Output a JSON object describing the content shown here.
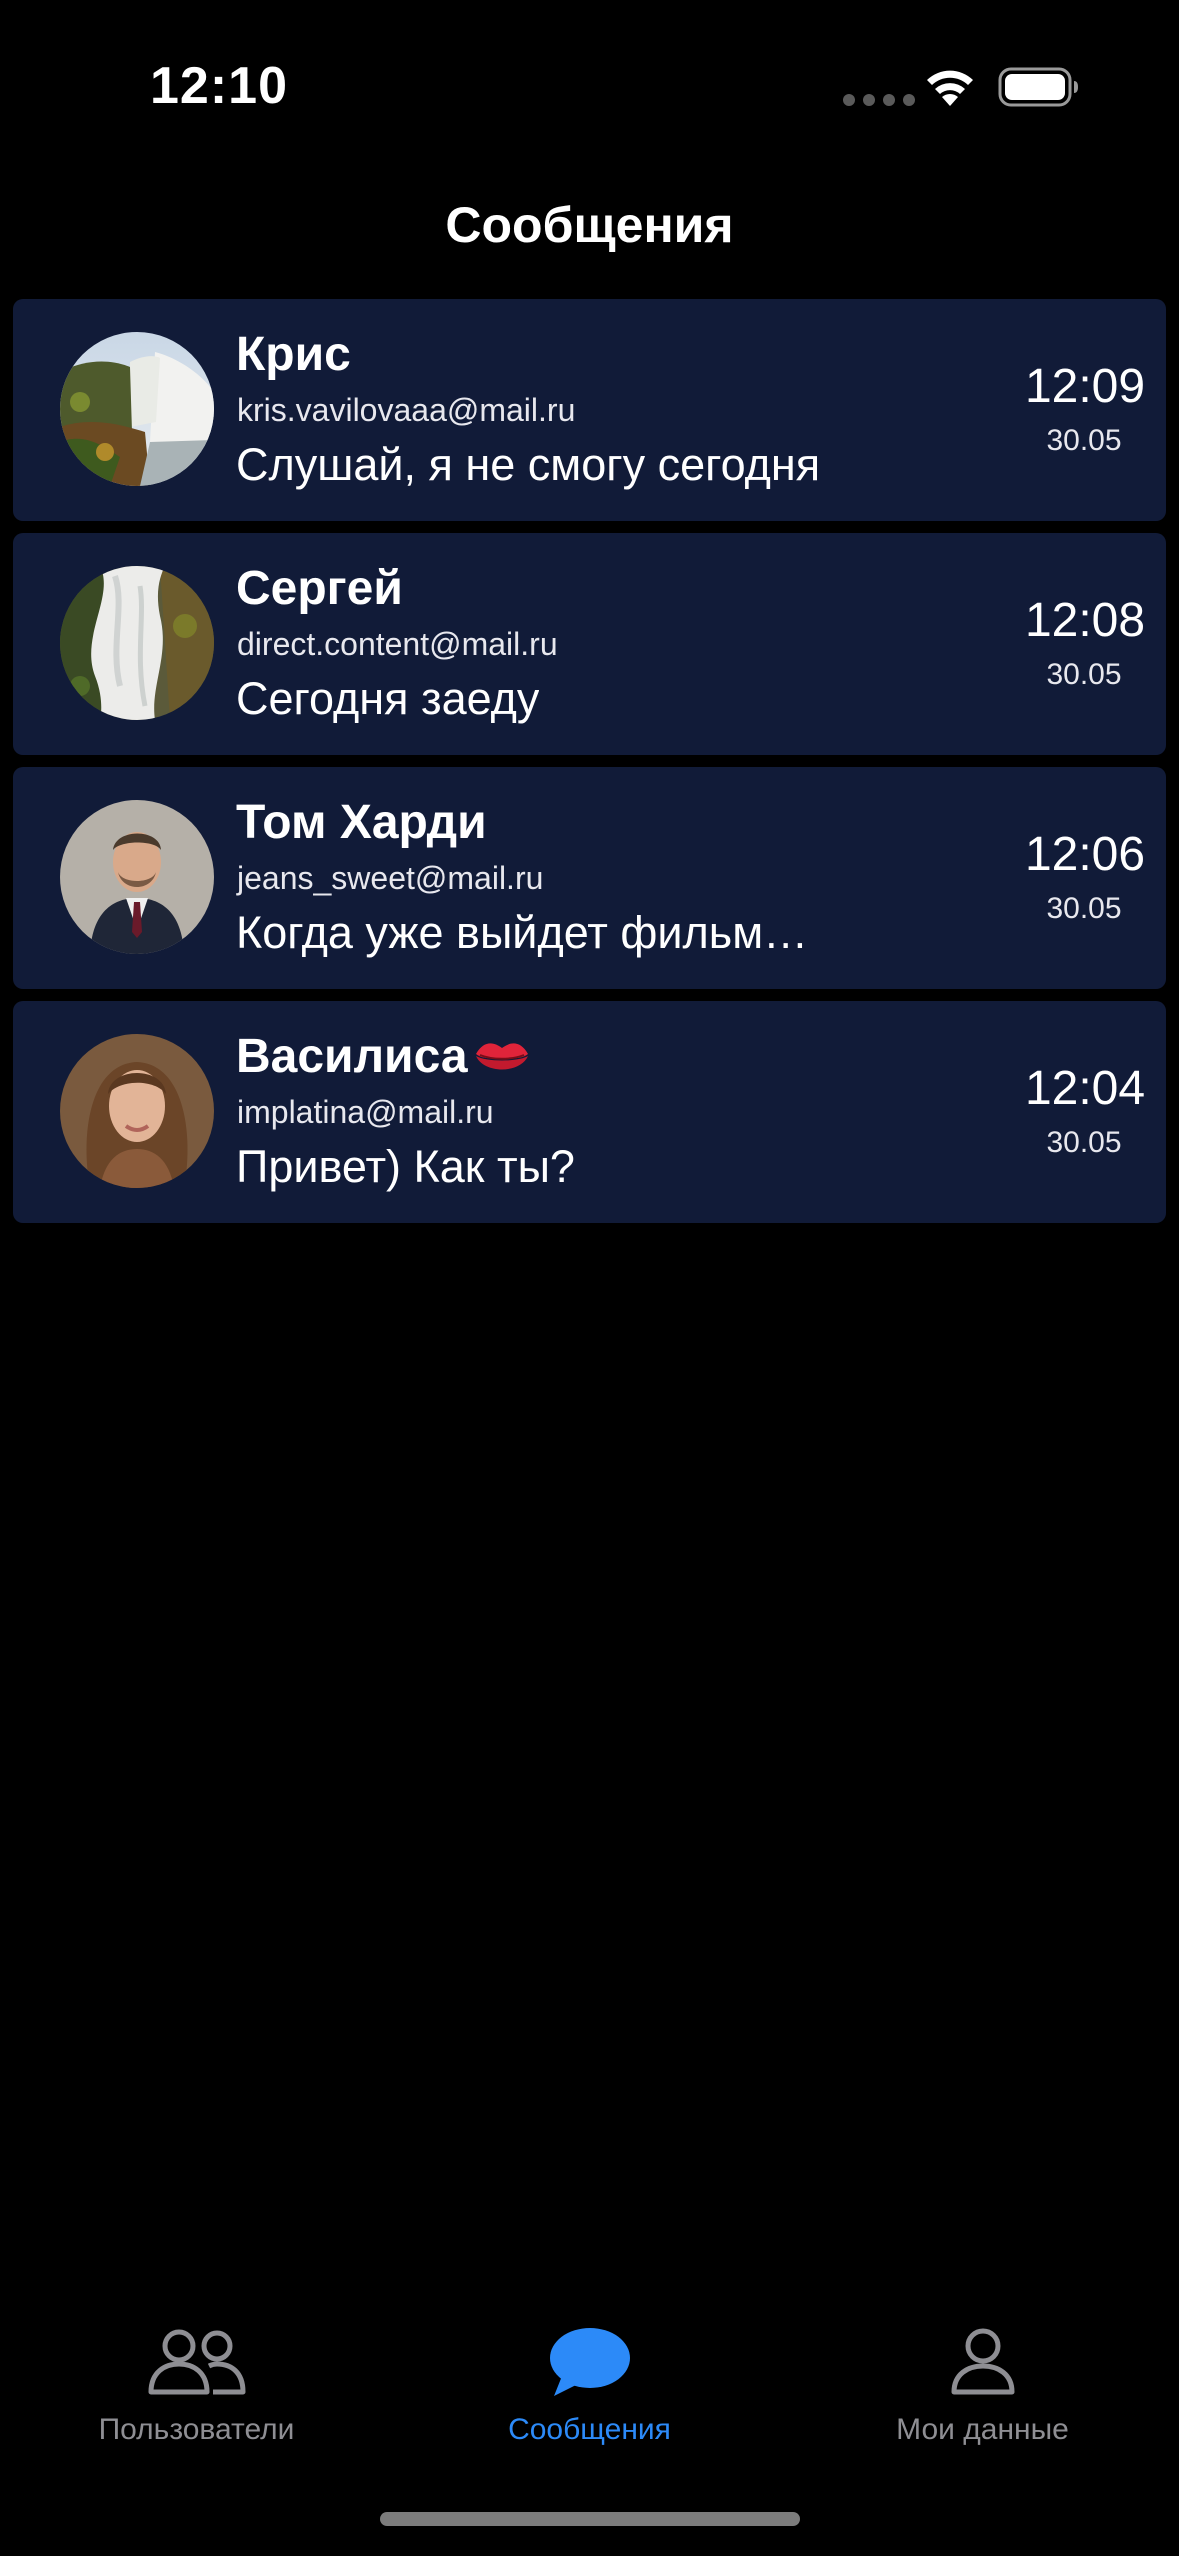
{
  "status_bar": {
    "time": "12:10"
  },
  "header": {
    "title": "Сообщения"
  },
  "messages": [
    {
      "name": "Крис",
      "email": "kris.vavilovaaa@mail.ru",
      "text": "Слушай, я не смогу сегодня",
      "time": "12:09",
      "date": "30.05",
      "avatar": "waterfall-photo"
    },
    {
      "name": "Сергей",
      "email": "direct.content@mail.ru",
      "text": "Сегодня заеду",
      "time": "12:08",
      "date": "30.05",
      "avatar": "waterfall-photo-2"
    },
    {
      "name": "Том Харди",
      "email": "jeans_sweet@mail.ru",
      "text": "Когда уже выйдет фильм…",
      "time": "12:06",
      "date": "30.05",
      "avatar": "man-in-suit-photo"
    },
    {
      "name": "Василиса",
      "email": "implatina@mail.ru",
      "text": "Привет) Как ты?",
      "time": "12:04",
      "date": "30.05",
      "avatar": "woman-portrait-photo",
      "name_emoji": "lips-icon"
    }
  ],
  "tab_bar": {
    "tabs": [
      {
        "label": "Пользователи",
        "icon": "users-icon",
        "active": false
      },
      {
        "label": "Сообщения",
        "icon": "chat-bubble-icon",
        "active": true
      },
      {
        "label": "Мои данные",
        "icon": "person-icon",
        "active": false
      }
    ]
  },
  "colors": {
    "background": "#000000",
    "card": "#111b38",
    "accent": "#2c8af8",
    "inactive": "#8e8e93"
  }
}
